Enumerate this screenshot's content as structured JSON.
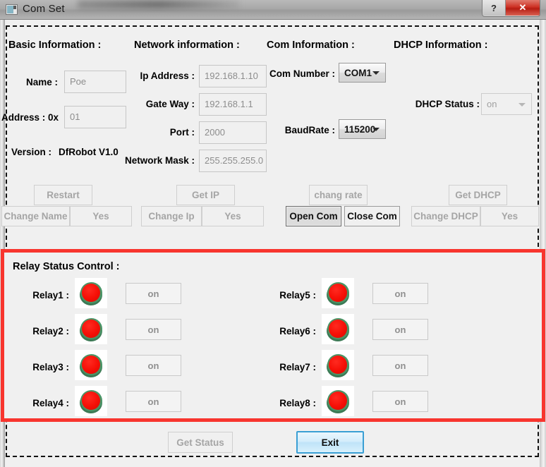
{
  "window": {
    "title": "Com Set",
    "icon": "application-window-icon",
    "caption_buttons": [
      {
        "name": "help-button",
        "label": "?"
      },
      {
        "name": "close-button",
        "label": "✕"
      }
    ]
  },
  "sections": {
    "basic": {
      "heading": "Basic Information :",
      "name_label": "Name :",
      "name_value": "Poe",
      "address_label": "Address : 0x",
      "address_value": "01",
      "version_label": "Version :",
      "version_value": "DfRobot V1.0"
    },
    "network": {
      "heading": "Network information :",
      "ip_label": "Ip Address :",
      "ip_value": "192.168.1.10",
      "gateway_label": "Gate Way :",
      "gateway_value": "192.168.1.1",
      "port_label": "Port :",
      "port_value": "2000",
      "mask_label": "Network Mask :",
      "mask_value": "255.255.255.0"
    },
    "com": {
      "heading": "Com Information :",
      "com_number_label": "Com Number :",
      "com_number_value": "COM1",
      "baudrate_label": "BaudRate :",
      "baudrate_value": "115200"
    },
    "dhcp": {
      "heading": "DHCP Information :",
      "status_label": "DHCP Status :",
      "status_value": "on"
    }
  },
  "actions": {
    "restart": "Restart",
    "change_name": "Change Name",
    "change_name_yes": "Yes",
    "get_ip": "Get IP",
    "change_ip": "Change Ip",
    "change_ip_yes": "Yes",
    "chang_rate": "chang rate",
    "open_com": "Open Com",
    "close_com": "Close Com",
    "get_dhcp": "Get DHCP",
    "change_dhcp": "Change DHCP",
    "change_dhcp_yes": "Yes",
    "get_status": "Get Status",
    "exit": "Exit"
  },
  "relay_panel": {
    "heading": "Relay Status Control :",
    "border_color": "#f8352e",
    "led_on_color": "#f50f06",
    "led_rim_color": "#4b9466",
    "rows": [
      {
        "label": "Relay1 :",
        "state": "on",
        "led": "red-led-icon"
      },
      {
        "label": "Relay2 :",
        "state": "on",
        "led": "red-led-icon"
      },
      {
        "label": "Relay3 :",
        "state": "on",
        "led": "red-led-icon"
      },
      {
        "label": "Relay4 :",
        "state": "on",
        "led": "red-led-icon"
      },
      {
        "label": "Relay5 :",
        "state": "on",
        "led": "red-led-icon"
      },
      {
        "label": "Relay6 :",
        "state": "on",
        "led": "red-led-icon"
      },
      {
        "label": "Relay7 :",
        "state": "on",
        "led": "red-led-icon"
      },
      {
        "label": "Relay8 :",
        "state": "on",
        "led": "red-led-icon"
      }
    ]
  }
}
